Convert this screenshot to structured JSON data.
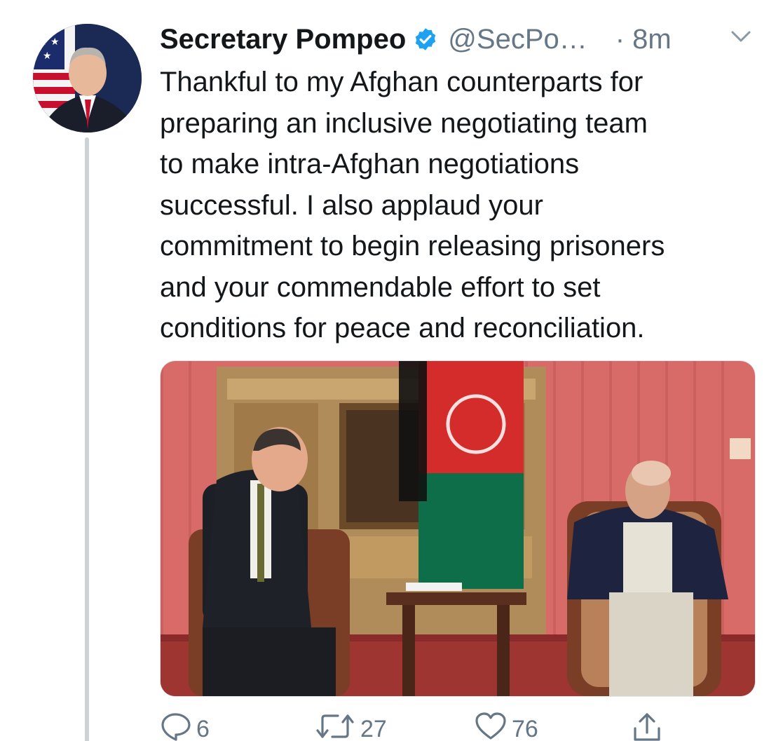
{
  "tweet": {
    "author_name": "Secretary Pompeo",
    "handle": "@SecPo…",
    "time": "· 8m",
    "text_lines": [
      "Thankful to my Afghan counterparts for",
      "preparing an inclusive negotiating team",
      "to make intra-Afghan negotiations",
      "successful. I also applaud your",
      "commitment to begin releasing prisoners",
      "and your commendable effort to set",
      "conditions for peace and reconciliation."
    ]
  },
  "actions": {
    "reply_count": "6",
    "retweet_count": "27",
    "like_count": "76"
  },
  "icons": {
    "verified": "verified-badge-icon",
    "caret": "chevron-down-icon",
    "reply": "reply-icon",
    "retweet": "retweet-icon",
    "like": "heart-icon",
    "share": "share-icon"
  },
  "colors": {
    "text": "#14171a",
    "secondary": "#657786",
    "verified": "#1da1f2",
    "thread_line": "#cbd2d8"
  }
}
